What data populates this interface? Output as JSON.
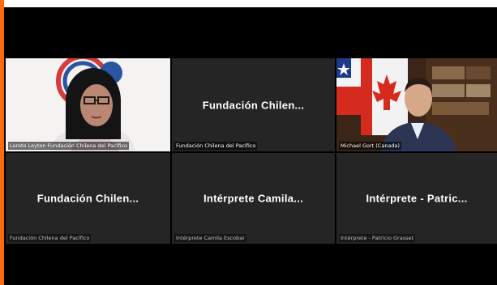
{
  "colors": {
    "accent": "#ff6a10",
    "tile_bg": "#252525"
  },
  "tiles": [
    {
      "display_name": "",
      "label": "Loreto Leyton Fundación Chilena del Pacífico",
      "type": "video-woman"
    },
    {
      "display_name": "Fundación  Chilen...",
      "label": "Fundación Chilena del Pacífico",
      "type": "name"
    },
    {
      "display_name": "",
      "label": "Michael Gort (Canada)",
      "type": "video-man"
    },
    {
      "display_name": "Fundación  Chilen...",
      "label": "Fundación Chilena del Pacífico",
      "type": "name"
    },
    {
      "display_name": "Intérprete  Camila...",
      "label": "Intérprete Camila Escobar",
      "type": "name"
    },
    {
      "display_name": "Intérprete  -  Patric...",
      "label": "Intérprete - Patricio Grasset",
      "type": "name"
    }
  ]
}
